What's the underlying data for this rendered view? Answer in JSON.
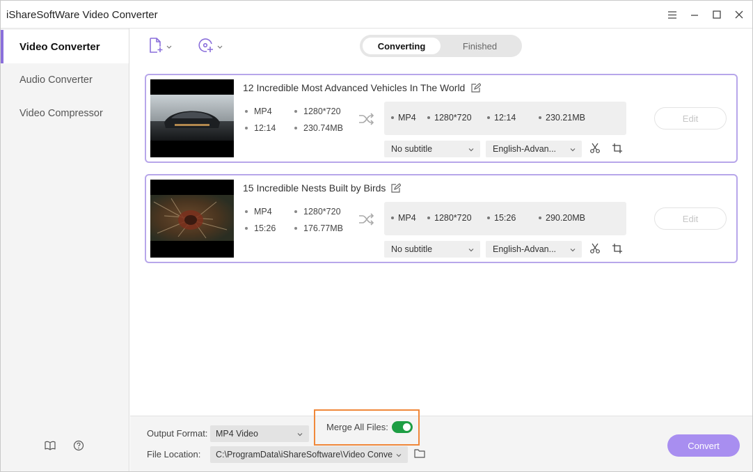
{
  "app": {
    "title": "iShareSoftWare Video Converter"
  },
  "window_controls": {
    "icons": [
      "menu-icon",
      "minimize-icon",
      "maximize-icon",
      "close-icon"
    ]
  },
  "sidebar": {
    "items": [
      {
        "label": "Video Converter",
        "active": true
      },
      {
        "label": "Audio Converter",
        "active": false
      },
      {
        "label": "Video Compressor",
        "active": false
      }
    ],
    "bottom_icons": [
      "book-icon",
      "help-icon"
    ]
  },
  "toolbar": {
    "add_file_icon": "add-file-icon",
    "add_disc_icon": "add-disc-icon"
  },
  "tabs": [
    {
      "label": "Converting",
      "active": true
    },
    {
      "label": "Finished",
      "active": false
    }
  ],
  "files": [
    {
      "title": "12 Incredible Most Advanced Vehicles In The World",
      "source": {
        "format": "MP4",
        "resolution": "1280*720",
        "duration": "12:14",
        "size": "230.74MB"
      },
      "target": {
        "format": "MP4",
        "resolution": "1280*720",
        "duration": "12:14",
        "size": "230.21MB"
      },
      "subtitle": "No subtitle",
      "audio": "English-Advan...",
      "edit_label": "Edit"
    },
    {
      "title": "15 Incredible Nests Built by Birds",
      "source": {
        "format": "MP4",
        "resolution": "1280*720",
        "duration": "15:26",
        "size": "176.77MB"
      },
      "target": {
        "format": "MP4",
        "resolution": "1280*720",
        "duration": "15:26",
        "size": "290.20MB"
      },
      "subtitle": "No subtitle",
      "audio": "English-Advan...",
      "edit_label": "Edit"
    }
  ],
  "footer": {
    "output_format_label": "Output Format:",
    "output_format_value": "MP4 Video",
    "merge_label": "Merge All Files:",
    "merge_enabled": true,
    "file_location_label": "File Location:",
    "file_location_value": "C:\\ProgramData\\iShareSoftware\\Video Conve",
    "convert_label": "Convert"
  },
  "colors": {
    "accent": "#8a6fdb",
    "convert_button": "#a88ef0",
    "toggle_on": "#1e9e44",
    "highlight_box": "#f0883a"
  }
}
